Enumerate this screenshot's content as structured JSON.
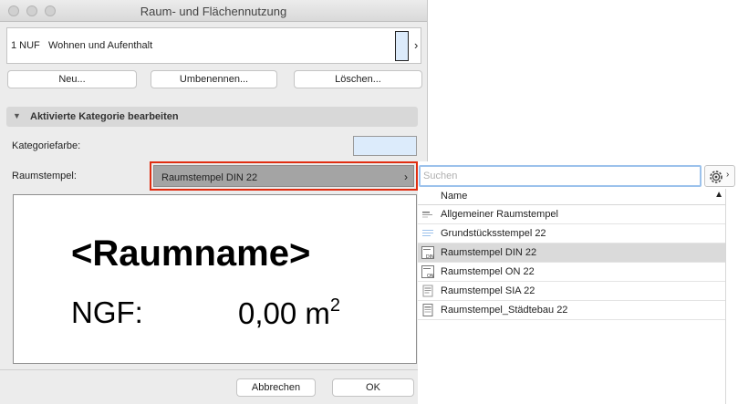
{
  "window": {
    "title": "Raum- und Flächennutzung"
  },
  "category": {
    "code": "1 NUF",
    "name": "Wohnen und Aufenthalt",
    "color": "#dcebfb"
  },
  "buttons": {
    "new": "Neu...",
    "rename": "Umbenennen...",
    "delete": "Löschen...",
    "cancel": "Abbrechen",
    "ok": "OK"
  },
  "section": {
    "title": "Aktivierte Kategorie bearbeiten"
  },
  "fields": {
    "color_label": "Kategoriefarbe:",
    "stamp_label": "Raumstempel:",
    "stamp_value": "Raumstempel DIN 22"
  },
  "preview": {
    "name": "<Raumname>",
    "ngf_label": "NGF:",
    "ngf_value": "0,00 m",
    "ngf_exp": "2"
  },
  "popover": {
    "search_placeholder": "Suchen",
    "column_header": "Name",
    "items": [
      {
        "label": "Allgemeiner Raumstempel",
        "icon": "stamp-generic-icon",
        "selected": false
      },
      {
        "label": "Grundstücksstempel 22",
        "icon": "stamp-plot-icon",
        "selected": false
      },
      {
        "label": "Raumstempel DIN 22",
        "icon": "stamp-din-icon",
        "selected": true
      },
      {
        "label": "Raumstempel ON 22",
        "icon": "stamp-on-icon",
        "selected": false
      },
      {
        "label": "Raumstempel SIA 22",
        "icon": "stamp-sia-icon",
        "selected": false
      },
      {
        "label": "Raumstempel_Städtebau 22",
        "icon": "stamp-urban-icon",
        "selected": false
      }
    ]
  },
  "colors": {
    "highlight_border": "#e02d10",
    "search_focus": "#9cc2ec",
    "selected_row": "#dadada"
  }
}
